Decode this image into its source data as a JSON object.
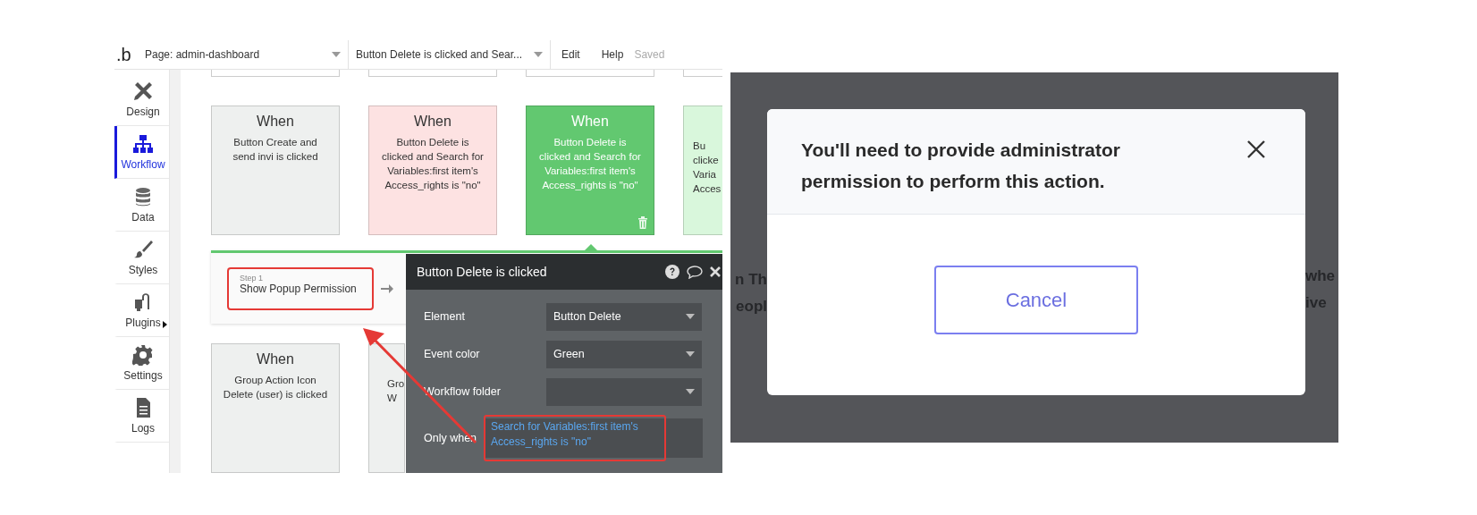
{
  "editor": {
    "logo": ".b",
    "page_select": "Page: admin-dashboard",
    "workflow_select": "Button Delete is clicked and Sear...",
    "menu": [
      "Edit",
      "Help"
    ],
    "save_status": "Saved",
    "sidebar": [
      {
        "label": "Design",
        "selected": false
      },
      {
        "label": "Workflow",
        "selected": true
      },
      {
        "label": "Data",
        "selected": false
      },
      {
        "label": "Styles",
        "selected": false
      },
      {
        "label": "Plugins",
        "selected": false
      },
      {
        "label": "Settings",
        "selected": false
      },
      {
        "label": "Logs",
        "selected": false
      }
    ],
    "event_cards": [
      {
        "title": "When",
        "lines": [
          "Button Create and",
          "send invi is clicked"
        ],
        "color": "#eef0ef",
        "selected": false,
        "cut": false
      },
      {
        "title": "When",
        "lines": [
          "Button Delete is",
          "clicked and Search for",
          "Variables:first item's",
          "Access_rights is \"no\""
        ],
        "color": "#fde2e2",
        "selected": false,
        "cut": false
      },
      {
        "title": "When",
        "lines": [
          "Button Delete is",
          "clicked and Search for",
          "Variables:first item's",
          "Access_rights is \"no\""
        ],
        "color": "#62c870",
        "selected": true,
        "cut": false
      },
      {
        "lines": [
          "Bu",
          "clicke",
          "Varia",
          "Acces"
        ],
        "color": "#d9f7dc",
        "selected": false,
        "cut": true
      }
    ],
    "step": {
      "label": "Step 1",
      "action": "Show Popup Permission"
    },
    "lower_cards": [
      {
        "title": "When",
        "lines": [
          "Group Action Icon",
          "Delete (user) is clicked"
        ],
        "color": "#eef0ef",
        "selected": false,
        "cut": false
      },
      {
        "lines": [
          "Gro",
          "W"
        ],
        "color": "#eef0ef",
        "selected": false,
        "cut": true
      }
    ],
    "property_panel": {
      "title": "Button Delete is clicked",
      "fields": [
        {
          "label": "Element",
          "value": "Button Delete"
        },
        {
          "label": "Event color",
          "value": "Green"
        },
        {
          "label": "Workflow folder"
        }
      ],
      "condition": {
        "label": "Only when",
        "expression": "Search for Variables:first item's Access_rights is \"no\""
      }
    }
  },
  "dialog": {
    "background_left": [
      "n Th",
      "eopl"
    ],
    "background_right": [
      "whe",
      "ive"
    ],
    "message": "You'll need to provide administrator permission to perform this action.",
    "button": "Cancel"
  }
}
